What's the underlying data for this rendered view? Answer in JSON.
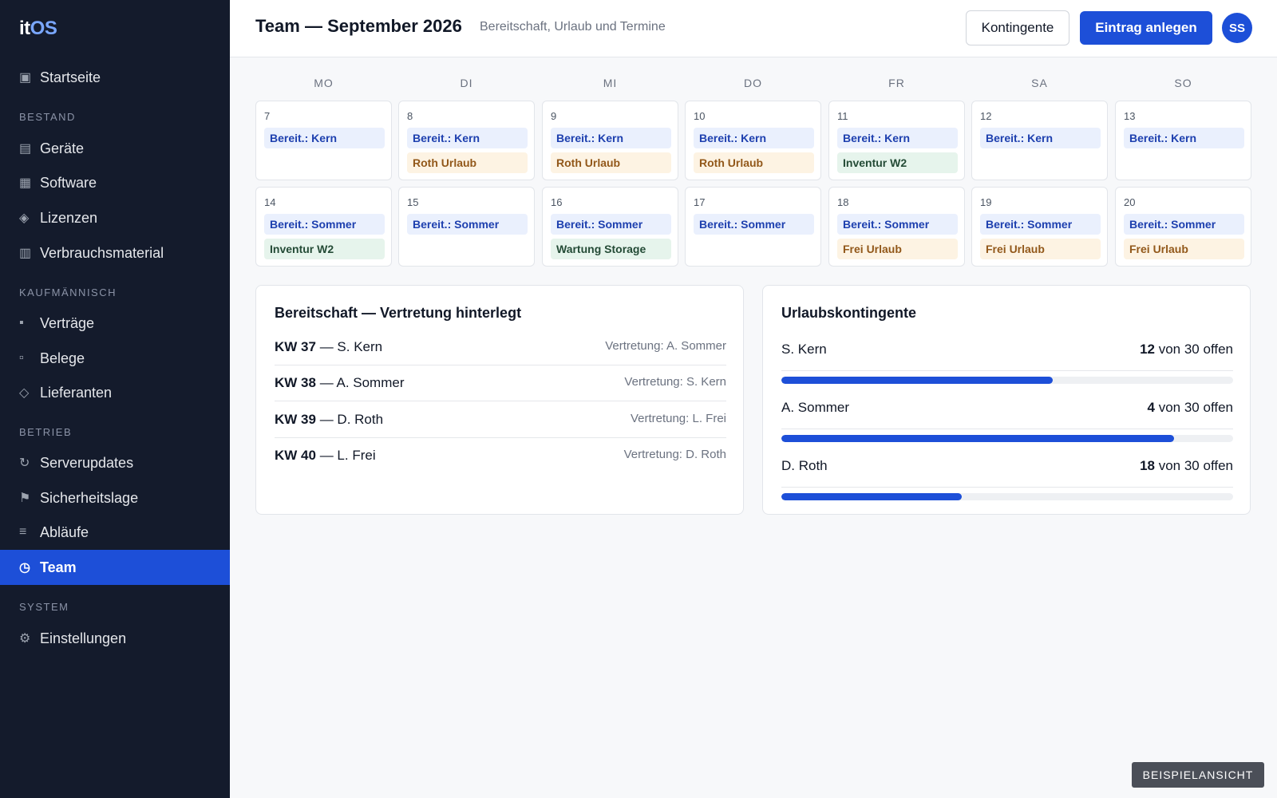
{
  "app": {
    "logo_a": "it",
    "logo_b": "OS"
  },
  "sidebar": {
    "home": {
      "icon": "dashboard-icon",
      "glyph": "▣",
      "label": "Startseite"
    },
    "sections": [
      {
        "label": "BESTAND"
      },
      {
        "label": "KAUFMÄNNISCH"
      },
      {
        "label": "BETRIEB"
      },
      {
        "label": "SYSTEM"
      }
    ],
    "items": [
      {
        "glyph": "▤",
        "label": "Geräte"
      },
      {
        "glyph": "▦",
        "label": "Software"
      },
      {
        "glyph": "◈",
        "label": "Lizenzen"
      },
      {
        "glyph": "▥",
        "label": "Verbrauchsmaterial"
      },
      {
        "glyph": "▪",
        "label": "Verträge"
      },
      {
        "glyph": "▫",
        "label": "Belege"
      },
      {
        "glyph": "◇",
        "label": "Lieferanten"
      },
      {
        "glyph": "↻",
        "label": "Serverupdates"
      },
      {
        "glyph": "⚑",
        "label": "Sicherheitslage"
      },
      {
        "glyph": "≡",
        "label": "Abläufe"
      },
      {
        "glyph": "◷",
        "label": "Team"
      },
      {
        "glyph": "⚙",
        "label": "Einstellungen"
      }
    ]
  },
  "header": {
    "title": "Team — September 2026",
    "subtitle": "Bereitschaft, Urlaub und Termine",
    "btn_quota": "Kontingente",
    "btn_create": "Eintrag anlegen",
    "avatar": "SS"
  },
  "calendar": {
    "weekdays": [
      "MO",
      "DI",
      "MI",
      "DO",
      "FR",
      "SA",
      "SO"
    ],
    "weeks": [
      [
        {
          "day": "7",
          "events": [
            {
              "text": "Bereit.: Kern",
              "kind": "blue"
            }
          ]
        },
        {
          "day": "8",
          "events": [
            {
              "text": "Bereit.: Kern",
              "kind": "blue"
            },
            {
              "text": "Roth Urlaub",
              "kind": "orange"
            }
          ]
        },
        {
          "day": "9",
          "events": [
            {
              "text": "Bereit.: Kern",
              "kind": "blue"
            },
            {
              "text": "Roth Urlaub",
              "kind": "orange"
            }
          ]
        },
        {
          "day": "10",
          "events": [
            {
              "text": "Bereit.: Kern",
              "kind": "blue"
            },
            {
              "text": "Roth Urlaub",
              "kind": "orange"
            }
          ]
        },
        {
          "day": "11",
          "events": [
            {
              "text": "Bereit.: Kern",
              "kind": "blue"
            },
            {
              "text": "Inventur W2",
              "kind": "green"
            }
          ]
        },
        {
          "day": "12",
          "events": [
            {
              "text": "Bereit.: Kern",
              "kind": "blue"
            }
          ]
        },
        {
          "day": "13",
          "events": [
            {
              "text": "Bereit.: Kern",
              "kind": "blue"
            }
          ]
        }
      ],
      [
        {
          "day": "14",
          "events": [
            {
              "text": "Bereit.: Sommer",
              "kind": "blue"
            },
            {
              "text": "Inventur W2",
              "kind": "green"
            }
          ]
        },
        {
          "day": "15",
          "events": [
            {
              "text": "Bereit.: Sommer",
              "kind": "blue"
            }
          ]
        },
        {
          "day": "16",
          "events": [
            {
              "text": "Bereit.: Sommer",
              "kind": "blue"
            },
            {
              "text": "Wartung Storage",
              "kind": "green"
            }
          ]
        },
        {
          "day": "17",
          "events": [
            {
              "text": "Bereit.: Sommer",
              "kind": "blue"
            }
          ]
        },
        {
          "day": "18",
          "events": [
            {
              "text": "Bereit.: Sommer",
              "kind": "blue"
            },
            {
              "text": "Frei Urlaub",
              "kind": "orange"
            }
          ]
        },
        {
          "day": "19",
          "events": [
            {
              "text": "Bereit.: Sommer",
              "kind": "blue"
            },
            {
              "text": "Frei Urlaub",
              "kind": "orange"
            }
          ]
        },
        {
          "day": "20",
          "events": [
            {
              "text": "Bereit.: Sommer",
              "kind": "blue"
            },
            {
              "text": "Frei Urlaub",
              "kind": "orange"
            }
          ]
        }
      ]
    ]
  },
  "oncall": {
    "title": "Bereitschaft — Vertretung hinterlegt",
    "rows": [
      {
        "week": "KW 37",
        "person": " — S. Kern",
        "rep": "Vertretung: A. Sommer"
      },
      {
        "week": "KW 38",
        "person": " — A. Sommer",
        "rep": "Vertretung: S. Kern"
      },
      {
        "week": "KW 39",
        "person": " — D. Roth",
        "rep": "Vertretung: L. Frei"
      },
      {
        "week": "KW 40",
        "person": " — L. Frei",
        "rep": "Vertretung: D. Roth"
      }
    ]
  },
  "quota": {
    "title": "Urlaubskontingente",
    "rows": [
      {
        "name": "S. Kern",
        "open": "12",
        "suffix": " von 30 offen",
        "used_fraction": 0.6
      },
      {
        "name": "A. Sommer",
        "open": "4",
        "suffix": " von 30 offen",
        "used_fraction": 0.87
      },
      {
        "name": "D. Roth",
        "open": "18",
        "suffix": " von 30 offen",
        "used_fraction": 0.4
      }
    ]
  },
  "footer_badge": "BEISPIELANSICHT",
  "colors": {
    "accent": "#1d4fd8",
    "sidebar": "#141b2c",
    "event_blue": "#eaf0fd",
    "event_orange": "#fdf3e3",
    "event_green": "#e6f4ec"
  }
}
